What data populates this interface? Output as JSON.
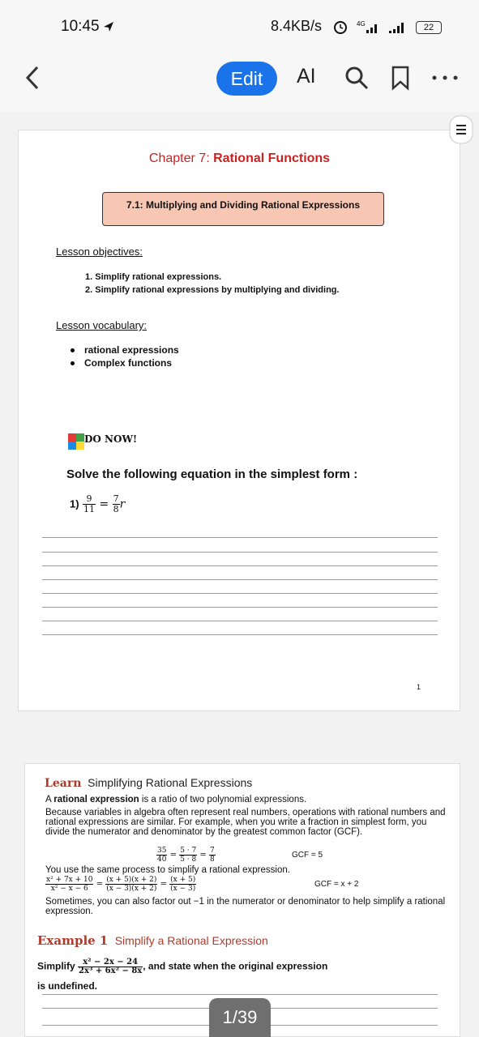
{
  "status": {
    "time": "10:45",
    "network": "8.4KB/s",
    "battery": "22"
  },
  "toolbar": {
    "edit": "Edit",
    "ai": "AI"
  },
  "page1": {
    "chapter_prefix": "Chapter 7: ",
    "chapter_title": "Rational Functions",
    "lesson_box": "7.1: Multiplying and Dividing Rational Expressions",
    "objectives_heading": "Lesson objectives:",
    "objectives": [
      "1.  Simplify rational expressions.",
      "2.  Simplify rational expressions by multiplying and dividing."
    ],
    "vocab_heading": "Lesson vocabulary:",
    "vocab": [
      "rational expressions",
      "Complex functions"
    ],
    "donow": "DO NOW!",
    "solve": "Solve the following equation in the simplest form :",
    "eq_num": "1)",
    "eq_frac1_n": "9",
    "eq_frac1_d": "11",
    "eq_eq": "=",
    "eq_frac2_n": "7",
    "eq_frac2_d": "8",
    "eq_var": "r",
    "page_number": "1"
  },
  "page2": {
    "learn": "Learn",
    "learn_title": "Simplifying Rational Expressions",
    "p1_bold": "rational expression",
    "p1_rest": " is a ratio of two polynomial expressions.",
    "p1_a": "A ",
    "p2": "Because variables in algebra often represent real numbers, operations with rational numbers and rational expressions are similar. For example, when you write a fraction in simplest form, you divide the numerator and denominator by the greatest common factor (GCF).",
    "m1_n": "35",
    "m1_d": "40",
    "m2_n": "5 · 7",
    "m2_d": "5 · 8",
    "m3_n": "7",
    "m3_d": "8",
    "gcf1": "GCF = 5",
    "p3": "You use the same process to simplify a rational expression.",
    "r1_n": "x² + 7x + 10",
    "r1_d": "x² − x − 6",
    "r2_n": "(x + 5)(x + 2)",
    "r2_d": "(x − 3)(x + 2)",
    "r3_n": "(x + 5)",
    "r3_d": "(x − 3)",
    "gcf2": "GCF = x + 2",
    "p4": "Sometimes, you can also factor out −1 in the numerator or denominator to help simplify a rational expression.",
    "example_label": "Example 1",
    "example_title": "Simplify a Rational Expression",
    "simplify": "Simplify",
    "ex_n": "x² − 2x − 24",
    "ex_d": "2x³ + 6x² − 8x",
    "ex_rest": ", and state when the original expression",
    "ex_rest2": "is undefined."
  },
  "pager": "1/39"
}
